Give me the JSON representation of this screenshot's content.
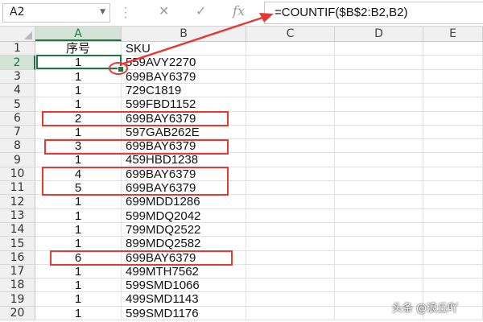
{
  "formula_bar": {
    "name_box": "A2",
    "formula": "=COUNTIF($B$2:B2,B2)",
    "cancel_icon": "x-icon",
    "enter_icon": "check-icon",
    "fx_label": "fx"
  },
  "columns": [
    "A",
    "B",
    "C",
    "D",
    "E"
  ],
  "rows": [
    {
      "n": "1",
      "a": "序号",
      "b": "SKU"
    },
    {
      "n": "2",
      "a": "1",
      "b": "559AVY2270"
    },
    {
      "n": "3",
      "a": "1",
      "b": "699BAY6379"
    },
    {
      "n": "4",
      "a": "1",
      "b": "729C1819"
    },
    {
      "n": "5",
      "a": "1",
      "b": "599FBD1152"
    },
    {
      "n": "6",
      "a": "2",
      "b": "699BAY6379"
    },
    {
      "n": "7",
      "a": "1",
      "b": "597GAB262E"
    },
    {
      "n": "8",
      "a": "3",
      "b": "699BAY6379"
    },
    {
      "n": "9",
      "a": "1",
      "b": "459HBD1238"
    },
    {
      "n": "10",
      "a": "4",
      "b": "699BAY6379"
    },
    {
      "n": "11",
      "a": "5",
      "b": "699BAY6379"
    },
    {
      "n": "12",
      "a": "1",
      "b": "699MDD1286"
    },
    {
      "n": "13",
      "a": "1",
      "b": "599MDQ2042"
    },
    {
      "n": "14",
      "a": "1",
      "b": "799MDQ2522"
    },
    {
      "n": "15",
      "a": "1",
      "b": "899MDQ2582"
    },
    {
      "n": "16",
      "a": "6",
      "b": "699BAY6379"
    },
    {
      "n": "17",
      "a": "1",
      "b": "499MTH7562"
    },
    {
      "n": "18",
      "a": "1",
      "b": "599SMD1066"
    },
    {
      "n": "19",
      "a": "1",
      "b": "499SMD1143"
    },
    {
      "n": "20",
      "a": "1",
      "b": "599SMD1176"
    }
  ],
  "watermark": "头条 @浪丘吖",
  "colors": {
    "accent": "#217346",
    "annotation": "#e53935"
  }
}
